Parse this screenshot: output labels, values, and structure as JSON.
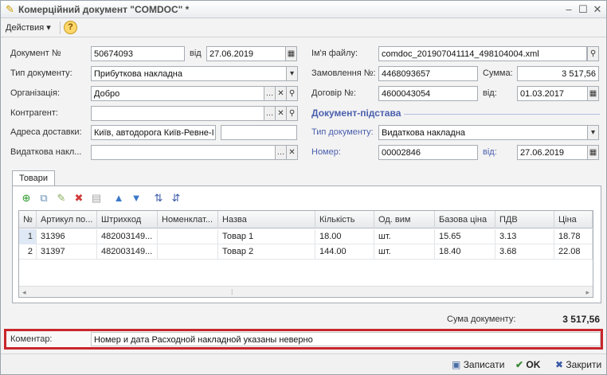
{
  "window": {
    "title": "Комерційний документ \"COMDOC\" *"
  },
  "toolbar": {
    "actions_label": "Действия",
    "help_label": "?"
  },
  "form": {
    "doc_number_label": "Документ №",
    "doc_number": "50674093",
    "from_label": "від",
    "doc_date": "27.06.2019",
    "doc_type_label": "Тип документу:",
    "doc_type": "Прибуткова накладна",
    "org_label": "Організація:",
    "org": "Добро",
    "contractor_label": "Контрагент:",
    "contractor": "",
    "address_label": "Адреса доставки:",
    "address": "Київ, автодорога Київ-Ревне-І",
    "address_extra": "",
    "expense_label": "Видаткова накл...",
    "expense": "",
    "file_label": "Ім'я файлу:",
    "file_name": "comdoc_201907041114_498104004.xml",
    "order_label": "Замовлення №:",
    "order_number": "4468093657",
    "sum_label": "Сумма:",
    "sum": "3 517,56",
    "contract_label": "Договір №:",
    "contract_number": "4600043054",
    "contract_from_label": "від:",
    "contract_date": "01.03.2017",
    "basis_title": "Документ-підстава",
    "basis_type_label": "Тип документу:",
    "basis_type": "Видаткова накладна",
    "basis_number_label": "Номер:",
    "basis_number": "00002846",
    "basis_from_label": "від:",
    "basis_date": "27.06.2019"
  },
  "tabs": {
    "goods": "Товари"
  },
  "grid": {
    "headers": [
      "№",
      "Артикул по...",
      "Штрихкод",
      "Номенклат...",
      "Назва",
      "Кількість",
      "Од. вим",
      "Базова ціна",
      "ПДВ",
      "Ціна"
    ],
    "rows": [
      [
        "1",
        "31396",
        "482003149...",
        "",
        "Товар 1",
        "18.00",
        "шт.",
        "15.65",
        "3.13",
        "18.78"
      ],
      [
        "2",
        "31397",
        "482003149...",
        "",
        "Товар 2",
        "144.00",
        "шт.",
        "18.40",
        "3.68",
        "22.08"
      ]
    ]
  },
  "totals": {
    "label": "Сума документу:",
    "value": "3 517,56"
  },
  "comment": {
    "label": "Коментар:",
    "value": "Номер и дата Расходной накладной указаны неверно"
  },
  "buttons": {
    "save": "Записати",
    "ok": "OK",
    "close": "Закрити"
  },
  "colors": {
    "accent_blue": "#4a5fae",
    "highlight_red": "#c8262c",
    "row_selected": "#dfe8f5"
  }
}
